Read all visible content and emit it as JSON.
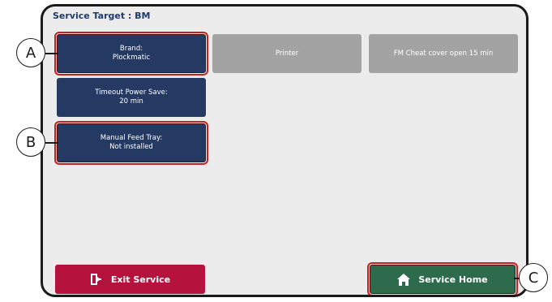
{
  "header": {
    "title": "Service Target : BM"
  },
  "tiles": [
    {
      "label": "Brand:\nPlockmatic",
      "state": "active",
      "highlighted": true
    },
    {
      "label": "Printer",
      "state": "disabled",
      "highlighted": false
    },
    {
      "label": "FM Cheat cover open 15 min",
      "state": "disabled",
      "highlighted": false
    },
    {
      "label": "Timeout Power Save:\n20 min",
      "state": "active",
      "highlighted": false
    },
    {
      "label": "Manual Feed Tray:\nNot installed",
      "state": "active",
      "highlighted": true
    }
  ],
  "footer": {
    "exit_label": "Exit Service",
    "exit_icon": "exit-door-icon",
    "home_label": "Service Home",
    "home_icon": "home-icon"
  },
  "callouts": {
    "a": "A",
    "b": "B",
    "c": "C"
  },
  "colors": {
    "navy_tile": "#243a63",
    "disabled_tile": "#a3a3a3",
    "exit_button": "#b5123e",
    "home_button": "#2e6b4c",
    "highlight_outline": "#c8201e",
    "title_text": "#1f3a6b"
  }
}
